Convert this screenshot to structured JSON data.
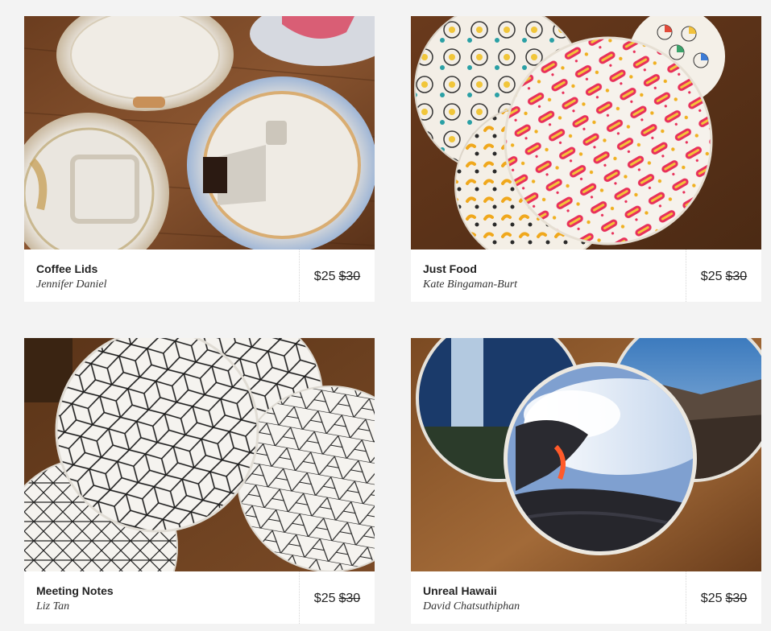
{
  "products": [
    {
      "title": "Coffee Lids",
      "artist": "Jennifer Daniel",
      "price": "$25",
      "old_price": "$30",
      "image": "coffee-lid-coasters-photo"
    },
    {
      "title": "Just Food",
      "artist": "Kate Bingaman-Burt",
      "price": "$25",
      "old_price": "$30",
      "image": "food-pattern-coasters-photo"
    },
    {
      "title": "Meeting Notes",
      "artist": "Liz Tan",
      "price": "$25",
      "old_price": "$30",
      "image": "geometric-pattern-coasters-photo"
    },
    {
      "title": "Unreal Hawaii",
      "artist": "David Chatsuthiphan",
      "price": "$25",
      "old_price": "$30",
      "image": "hawaii-landscape-coasters-photo"
    }
  ]
}
